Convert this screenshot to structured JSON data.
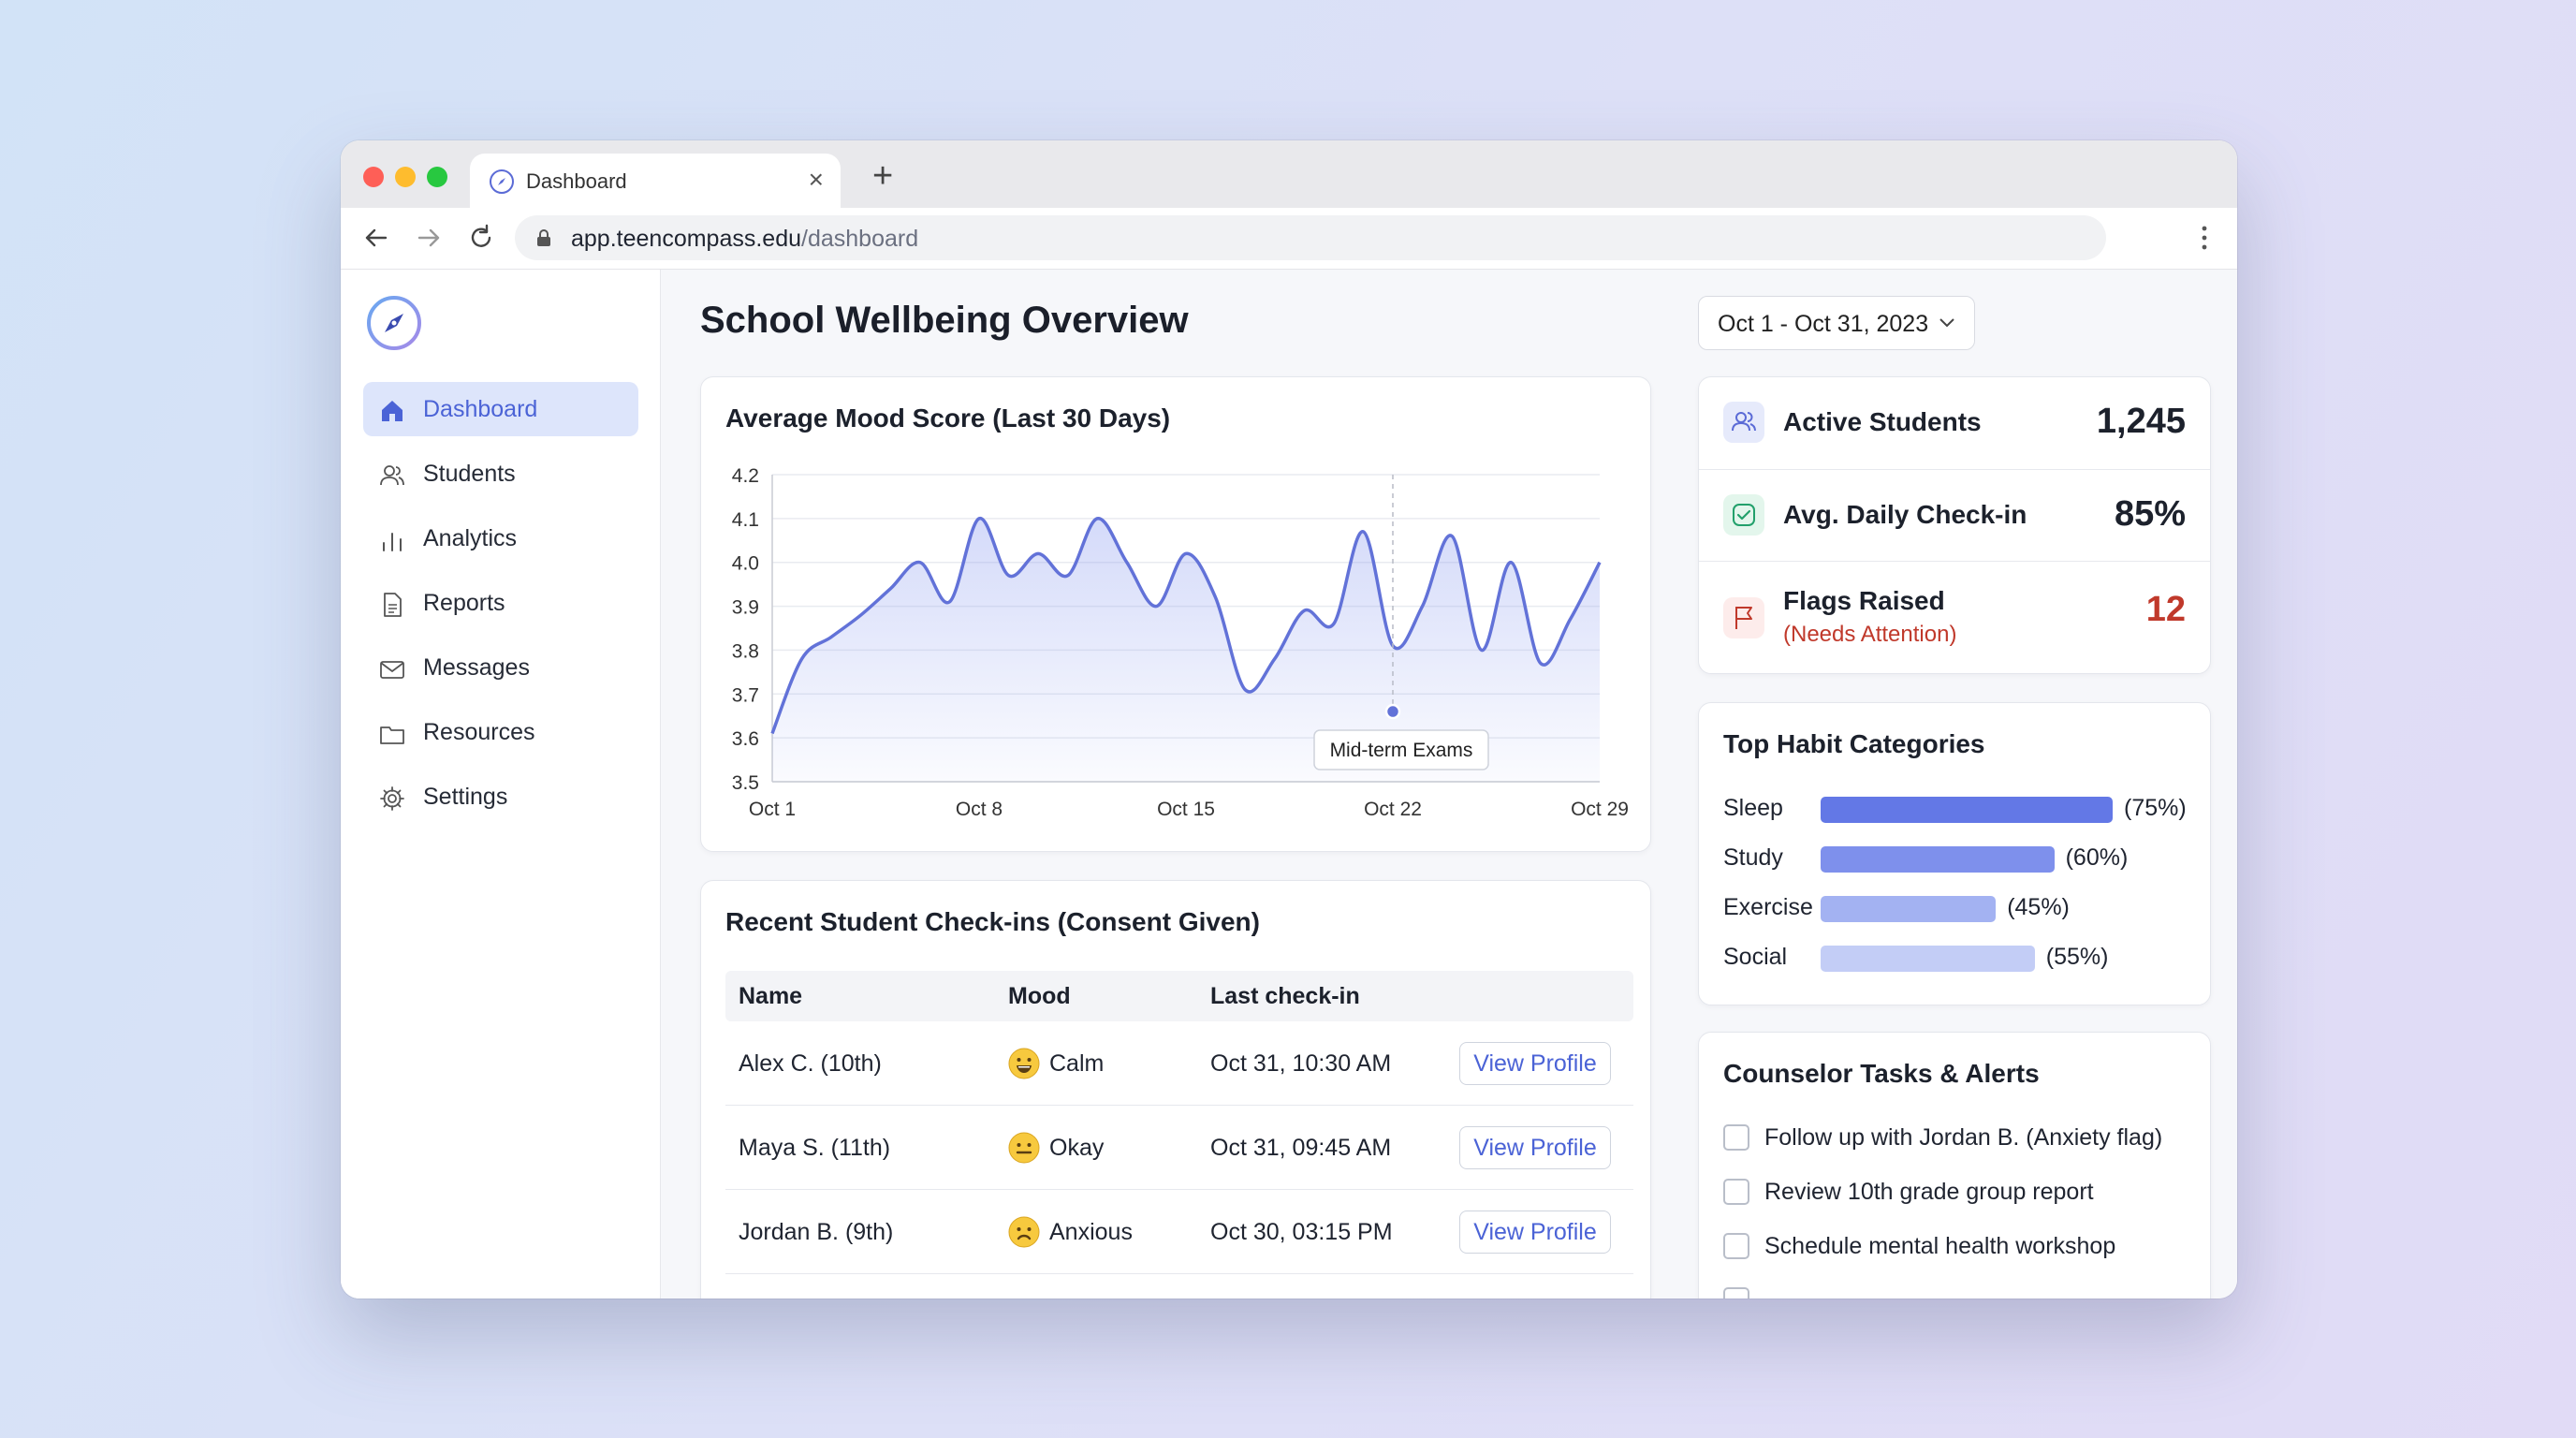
{
  "browser": {
    "tab_title": "Dashboard",
    "tab_close": "×",
    "new_tab": "+",
    "url_domain": "app.teencompass.edu",
    "url_path": "/dashboard"
  },
  "sidebar": {
    "items": [
      {
        "label": "Dashboard",
        "icon": "home-icon"
      },
      {
        "label": "Students",
        "icon": "users-icon"
      },
      {
        "label": "Analytics",
        "icon": "bar-chart-icon"
      },
      {
        "label": "Reports",
        "icon": "document-icon"
      },
      {
        "label": "Messages",
        "icon": "mail-icon"
      },
      {
        "label": "Resources",
        "icon": "folder-icon"
      },
      {
        "label": "Settings",
        "icon": "gear-icon"
      }
    ]
  },
  "header": {
    "title": "School Wellbeing Overview",
    "date_range": "Oct 1 - Oct 31, 2023"
  },
  "chart_data": {
    "type": "line",
    "title": "Average Mood Score (Last 30 Days)",
    "xlabel": "",
    "ylabel": "",
    "x_ticks": [
      "Oct 1",
      "Oct 8",
      "Oct 15",
      "Oct 22",
      "Oct 29"
    ],
    "y_ticks": [
      4.2,
      4.1,
      4.0,
      3.9,
      3.8,
      3.7,
      3.6,
      3.5
    ],
    "ylim": [
      3.5,
      4.2
    ],
    "xlim": [
      1,
      29
    ],
    "series": [
      {
        "color": "#6272d8",
        "x": [
          1,
          2,
          3,
          4,
          5,
          6,
          7,
          8,
          9,
          10,
          11,
          12,
          13,
          14,
          15,
          16,
          17,
          18,
          19,
          20,
          21,
          22,
          23,
          24,
          25,
          26,
          27,
          28,
          29
        ],
        "values": [
          3.61,
          3.78,
          3.83,
          3.88,
          3.94,
          4.0,
          3.91,
          4.1,
          3.97,
          4.02,
          3.97,
          4.1,
          4.0,
          3.9,
          4.02,
          3.92,
          3.71,
          3.78,
          3.89,
          3.86,
          4.07,
          3.81,
          3.9,
          4.06,
          3.8,
          4.0,
          3.77,
          3.87,
          4.0
        ]
      }
    ],
    "annotation": {
      "label": "Mid-term Exams",
      "x": 22,
      "y": 3.66
    },
    "grid": true
  },
  "checkins": {
    "title": "Recent Student Check-ins (Consent Given)",
    "columns": [
      "Name",
      "Mood",
      "Last check-in"
    ],
    "rows": [
      {
        "name": "Alex C. (10th)",
        "mood": "Calm",
        "mood_icon": "smile-icon",
        "time": "Oct 31, 10:30 AM",
        "action": "View Profile"
      },
      {
        "name": "Maya S. (11th)",
        "mood": "Okay",
        "mood_icon": "neutral-face-icon",
        "time": "Oct 31, 09:45 AM",
        "action": "View Profile"
      },
      {
        "name": "Jordan B. (9th)",
        "mood": "Anxious",
        "mood_icon": "worried-face-icon",
        "time": "Oct 30, 03:15 PM",
        "action": "View Profile"
      }
    ]
  },
  "stats": [
    {
      "label": "Active Students",
      "value": "1,245",
      "icon": "users-icon",
      "icon_color": "#5b6bd6",
      "icon_bg": "#e6eafb"
    },
    {
      "label": "Avg. Daily Check-in",
      "value": "85%",
      "icon": "check-square-icon",
      "icon_color": "#22a06b",
      "icon_bg": "#e3f6ec"
    },
    {
      "label": "Flags Raised",
      "sub": "(Needs Attention)",
      "value": "12",
      "icon": "flag-icon",
      "icon_color": "#c0392b",
      "icon_bg": "#fdeceb"
    }
  ],
  "habits": {
    "title": "Top Habit Categories",
    "items": [
      {
        "name": "Sleep",
        "pct": 75,
        "pct_label": "(75%)",
        "color": "#6378e6"
      },
      {
        "name": "Study",
        "pct": 60,
        "pct_label": "(60%)",
        "color": "#7e90ec"
      },
      {
        "name": "Exercise",
        "pct": 45,
        "pct_label": "(45%)",
        "color": "#a3b2f2"
      },
      {
        "name": "Social",
        "pct": 55,
        "pct_label": "(55%)",
        "color": "#c3cdf6"
      }
    ]
  },
  "tasks": {
    "title": "Counselor Tasks & Alerts",
    "items": [
      "Follow up with Jordan B. (Anxiety flag)",
      "Review 10th grade group report",
      "Schedule mental health workshop"
    ]
  }
}
